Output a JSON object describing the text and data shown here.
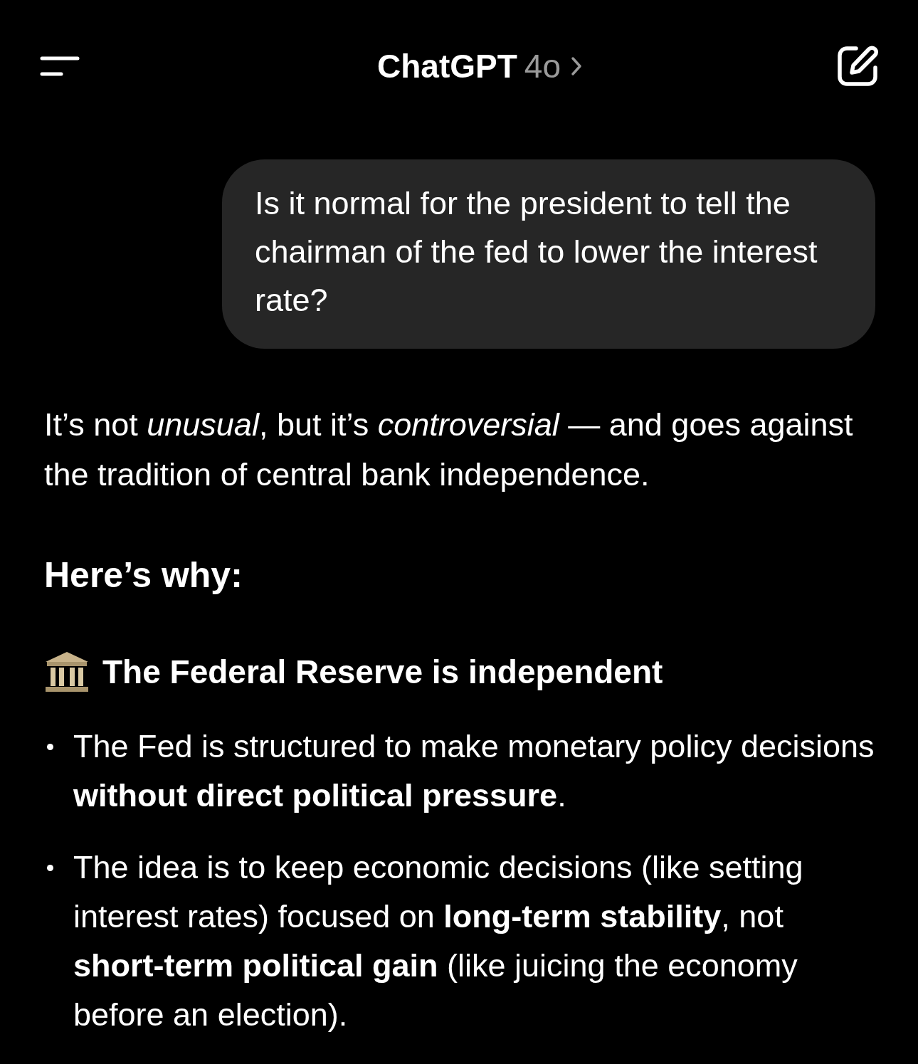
{
  "header": {
    "title": "ChatGPT",
    "model": "4o"
  },
  "user_message": "Is it normal for the president to tell the chairman of the fed to lower the interest rate?",
  "response": {
    "intro": "It’s not *unusual*, but it’s *controversial* — and goes against the tradition of central bank independence.",
    "heading": "Here’s why:",
    "sections": [
      {
        "title": "The Federal Reserve is independent",
        "bullets": [
          "The Fed is structured to make monetary policy decisions **without direct political pressure**.",
          "The idea is to keep economic decisions (like setting interest rates) focused on **long-term stability**, not **short-term political gain** (like juicing the economy before an election)."
        ]
      }
    ]
  }
}
